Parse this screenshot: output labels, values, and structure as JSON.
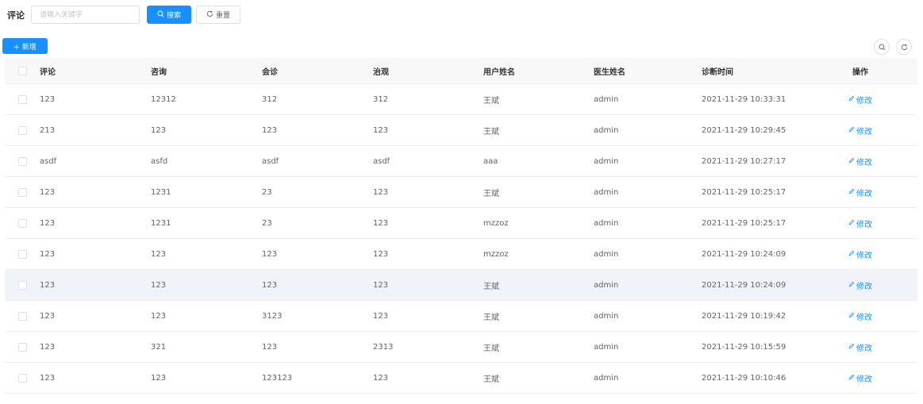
{
  "search": {
    "label": "评论",
    "placeholder": "请输入关键字",
    "search_button": "搜索",
    "reset_button": "重置"
  },
  "toolbar": {
    "add_button": "+ 新增"
  },
  "table": {
    "headers": [
      "评论",
      "咨询",
      "会诊",
      "治观",
      "用户姓名",
      "医生姓名",
      "诊断时间",
      "操作"
    ],
    "edit_label": "修改",
    "rows": [
      {
        "c1": "123",
        "c2": "12312",
        "c3": "312",
        "c4": "312",
        "c5": "王斌",
        "c6": "admin",
        "c7": "2021-11-29 10:33:31"
      },
      {
        "c1": "213",
        "c2": "123",
        "c3": "123",
        "c4": "123",
        "c5": "王斌",
        "c6": "admin",
        "c7": "2021-11-29 10:29:45"
      },
      {
        "c1": "asdf",
        "c2": "asfd",
        "c3": "asdf",
        "c4": "asdf",
        "c5": "aaa",
        "c6": "admin",
        "c7": "2021-11-29 10:27:17"
      },
      {
        "c1": "123",
        "c2": "1231",
        "c3": "23",
        "c4": "123",
        "c5": "王斌",
        "c6": "admin",
        "c7": "2021-11-29 10:25:17"
      },
      {
        "c1": "123",
        "c2": "1231",
        "c3": "23",
        "c4": "123",
        "c5": "mzzoz",
        "c6": "admin",
        "c7": "2021-11-29 10:25:17"
      },
      {
        "c1": "123",
        "c2": "123",
        "c3": "123",
        "c4": "123",
        "c5": "mzzoz",
        "c6": "admin",
        "c7": "2021-11-29 10:24:09"
      },
      {
        "c1": "123",
        "c2": "123",
        "c3": "123",
        "c4": "123",
        "c5": "王斌",
        "c6": "admin",
        "c7": "2021-11-29 10:24:09"
      },
      {
        "c1": "123",
        "c2": "123",
        "c3": "3123",
        "c4": "123",
        "c5": "王斌",
        "c6": "admin",
        "c7": "2021-11-29 10:19:42"
      },
      {
        "c1": "123",
        "c2": "321",
        "c3": "123",
        "c4": "2313",
        "c5": "王斌",
        "c6": "admin",
        "c7": "2021-11-29 10:15:59"
      },
      {
        "c1": "123",
        "c2": "123",
        "c3": "123123",
        "c4": "123",
        "c5": "王斌",
        "c6": "admin",
        "c7": "2021-11-29 10:10:46"
      }
    ]
  },
  "icons": {
    "search": "search-icon",
    "reset": "refresh-icon",
    "edit": "edit-icon"
  },
  "colors": {
    "primary": "#1890ff",
    "header_bg": "#f8f8f9",
    "highlight_row": "#f0f4f8"
  }
}
